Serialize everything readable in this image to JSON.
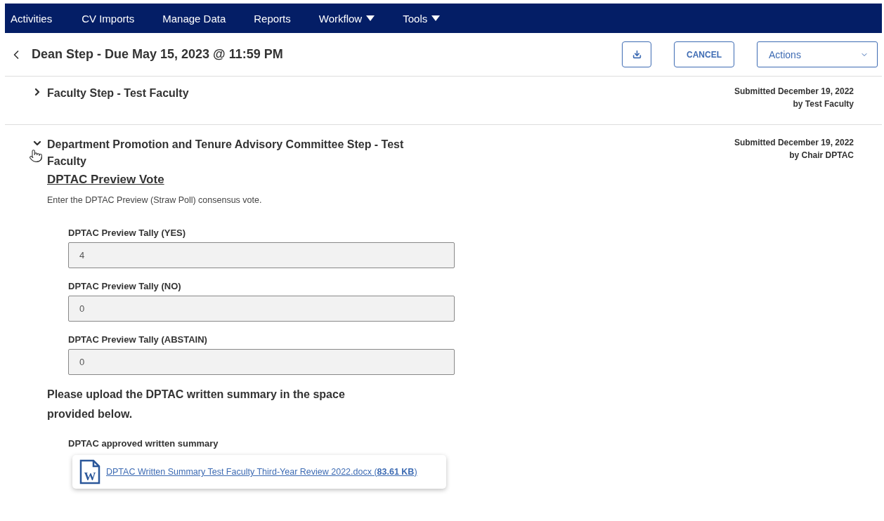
{
  "nav": [
    {
      "label": "Activities",
      "dropdown": false
    },
    {
      "label": "CV Imports",
      "dropdown": false
    },
    {
      "label": "Manage Data",
      "dropdown": false
    },
    {
      "label": "Reports",
      "dropdown": false
    },
    {
      "label": "Workflow",
      "dropdown": true
    },
    {
      "label": "Tools",
      "dropdown": true
    }
  ],
  "header": {
    "title": "Dean Step - Due May 15, 2023 @ 11:59 PM",
    "cancel": "CANCEL",
    "actions": "Actions"
  },
  "steps": [
    {
      "title": "Faculty Step - Test Faculty",
      "submitted": "Submitted December 19, 2022",
      "by": "by Test Faculty",
      "expanded": false
    },
    {
      "title": "Department Promotion and Tenure Advisory Committee Step - Test Faculty",
      "submitted": "Submitted December 19, 2022",
      "by": "by Chair DPTAC",
      "expanded": true,
      "form": {
        "heading": "DPTAC Preview Vote",
        "description": "Enter the DPTAC Preview (Straw Poll) consensus vote.",
        "fields": [
          {
            "label": "DPTAC Preview Tally (YES)",
            "value": "4"
          },
          {
            "label": "DPTAC Preview Tally (NO)",
            "value": "0"
          },
          {
            "label": "DPTAC Preview Tally (ABSTAIN)",
            "value": "0"
          }
        ],
        "upload_prompt": "Please upload the DPTAC written summary in the space provided below.",
        "attachment": {
          "label": "DPTAC approved written summary",
          "icon_letter": "W",
          "file": "DPTAC Written Summary Test Faculty Third-Year Review 2022.docx (**83.61 KB**)"
        }
      }
    }
  ]
}
